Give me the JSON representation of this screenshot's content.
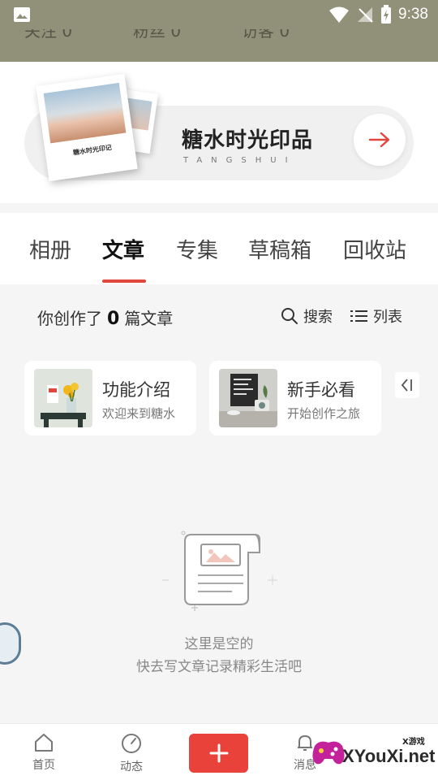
{
  "status_bar": {
    "time": "9:38"
  },
  "header": {
    "stats": [
      "关注 0",
      "粉丝 0",
      "访客 0"
    ]
  },
  "promo": {
    "title": "糖水时光印品",
    "subtitle": "TANGSHUI",
    "book_label": "糖水时光印记"
  },
  "tabs": [
    {
      "label": "相册",
      "active": false
    },
    {
      "label": "文章",
      "active": true
    },
    {
      "label": "专集",
      "active": false
    },
    {
      "label": "草稿箱",
      "active": false
    },
    {
      "label": "回收站",
      "active": false
    }
  ],
  "summary": {
    "prefix": "你创作了",
    "count": "0",
    "suffix": "篇文章"
  },
  "actions": {
    "search": "搜索",
    "list": "列表"
  },
  "cards": [
    {
      "title": "功能介绍",
      "subtitle": "欢迎来到糖水"
    },
    {
      "title": "新手必看",
      "subtitle": "开始创作之旅"
    }
  ],
  "empty_state": {
    "line1": "这里是空的",
    "line2": "快去写文章记录精彩生活吧"
  },
  "bottom_nav": {
    "home": "首页",
    "feed": "动态",
    "messages": "消息"
  },
  "watermark": {
    "brand": "XYouXi.net",
    "small": "X游戏"
  },
  "colors": {
    "accent": "#e8423b",
    "header": "#919078"
  }
}
